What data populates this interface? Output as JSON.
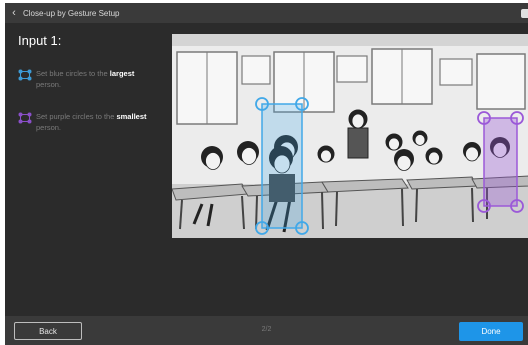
{
  "window": {
    "title": "Close-up by Gesture Setup",
    "back_icon": "chevron-left-icon"
  },
  "main": {
    "input_title": "Input 1:",
    "instructions": [
      {
        "icon": "blue-corner-circles-icon",
        "color": "#3d9bd6",
        "prefix": "Set blue circles to the ",
        "emphasis": "largest",
        "suffix": " person."
      },
      {
        "icon": "purple-corner-circles-icon",
        "color": "#8a4fc8",
        "prefix": "Set purple circles to the ",
        "emphasis": "smallest",
        "suffix": " person."
      }
    ],
    "scene": {
      "description_kind": "classroom-illustration",
      "blue_marker_color": "#41a8e8",
      "purple_marker_color": "#9b59d8"
    }
  },
  "footer": {
    "back_label": "Back",
    "page_indicator": "2/2",
    "done_label": "Done",
    "done_color": "#1e95e8"
  }
}
